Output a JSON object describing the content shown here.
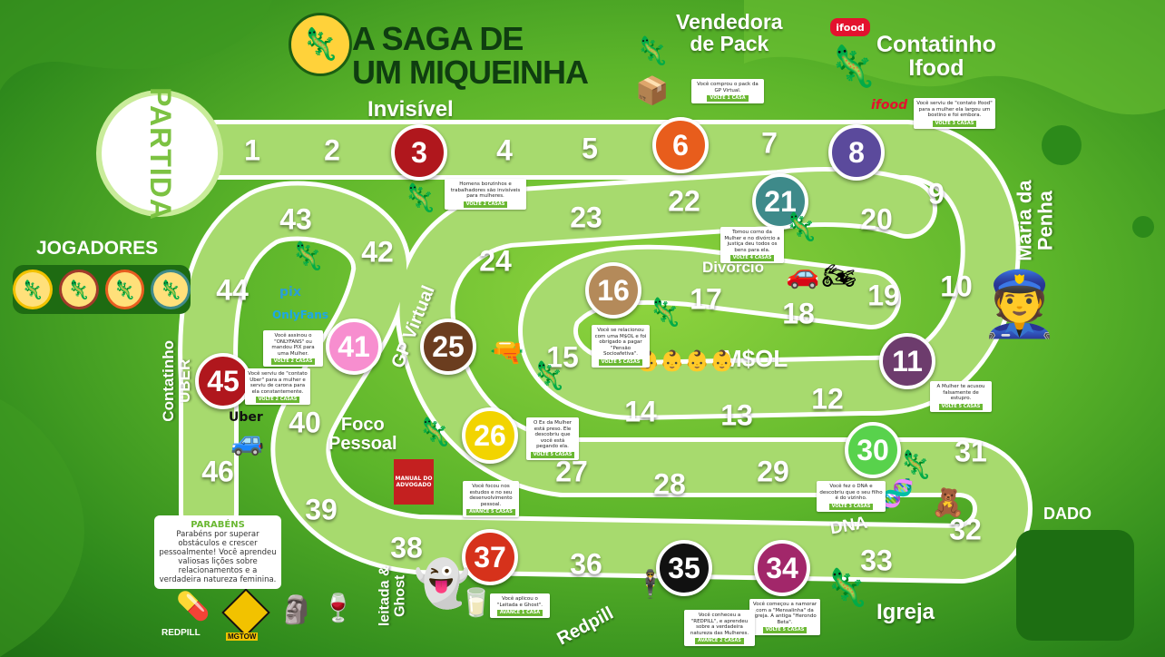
{
  "game": {
    "title_line1": "A SAGA DE",
    "title_line2": "UM MIQUEINHA",
    "start": "PARTIDA",
    "players_title": "JOGADORES",
    "dice_label": "DADO"
  },
  "players": [
    {
      "color": "#f2c200",
      "icon": "shrek-icon"
    },
    {
      "color": "#a23a2a",
      "icon": "shrek-icon"
    },
    {
      "color": "#e85d20",
      "icon": "shrek-icon"
    },
    {
      "color": "#3f8a8a",
      "icon": "shrek-icon"
    }
  ],
  "circles": [
    {
      "n": "3",
      "color": "#b0171d"
    },
    {
      "n": "6",
      "color": "#e85d1c"
    },
    {
      "n": "8",
      "color": "#5b4a9c"
    },
    {
      "n": "11",
      "color": "#6d3c6d"
    },
    {
      "n": "16",
      "color": "#b48a5a"
    },
    {
      "n": "21",
      "color": "#3e8a8a"
    },
    {
      "n": "25",
      "color": "#6b3d1f"
    },
    {
      "n": "26",
      "color": "#f2d400"
    },
    {
      "n": "30",
      "color": "#58d24c"
    },
    {
      "n": "34",
      "color": "#a2276a"
    },
    {
      "n": "35",
      "color": "#111111"
    },
    {
      "n": "37",
      "color": "#d6321b"
    },
    {
      "n": "41",
      "color": "#f78ecf"
    },
    {
      "n": "45",
      "color": "#b0171d"
    }
  ],
  "plain_numbers": [
    "1",
    "2",
    "4",
    "5",
    "7",
    "9",
    "10",
    "12",
    "13",
    "14",
    "15",
    "17",
    "18",
    "19",
    "20",
    "22",
    "23",
    "24",
    "27",
    "28",
    "29",
    "31",
    "32",
    "33",
    "36",
    "38",
    "39",
    "40",
    "42",
    "43",
    "44",
    "46"
  ],
  "labels": {
    "invisivel": "Invisível",
    "vendedora": "Vendedora\nde Pack",
    "ifood": "Contatinho\nIfood",
    "maria": "Maria da\nPenha",
    "divorcio": "Divórcio",
    "msol": "M$OL",
    "gp": "GP Virtual",
    "foco": "Foco\nPessoal",
    "uber": "Contatinho\nUBER",
    "dna": "DNA",
    "igreja": "Igreja",
    "redpill": "Redpill",
    "leitada": "leitada &\nGhost"
  },
  "logos": {
    "ifood": "ifood",
    "pix": "pix",
    "onlyfans": "OnlyFans",
    "uber": "Uber",
    "manual": "MANUAL DO ADVOGADO",
    "redpill_icon": "REDPILL",
    "mgtow_icon": "MGTOW"
  },
  "cards": {
    "c3": {
      "text": "Homens bonzinhos e trabalhadores são invisíveis para mulheres.",
      "action": "VOLTE 2 CASAS"
    },
    "c6": {
      "text": "Você comprou o pack da GP Virtual.",
      "action": "VOLTE 1 CASA"
    },
    "c8": {
      "text": "Você serviu de \"contato Ifood\" para a mulher ela largou um bostino e foi embora.",
      "action": "VOLTE 3 CASAS"
    },
    "c11": {
      "text": "A Mulher te acusou falsamente de estupro.",
      "action": "VOLTE 5 CASAS"
    },
    "c16": {
      "text": "Você se relacionou com uma M$OL e foi obrigado a pagar \"Pensão Socioafetiva\".",
      "action": "VOLTE 5 CASAS"
    },
    "c21": {
      "text": "Tomou corno da Mulher e no divórcio a justiça deu todos os bens para ela.",
      "action": "VOLTE 4 CASAS"
    },
    "c25": {
      "text": "O Ex da Mulher está preso. Ele descobriu que você está pegando ela.",
      "action": "VOLTE 5 CASAS"
    },
    "c26": {
      "text": "Você focou nos estudos e no seu desenvolvimento pessoal.",
      "action": "AVANCE 5 CASAS"
    },
    "c30": {
      "text": "Você fez o DNA e descobriu que o seu filho é do vizinho.",
      "action": "VOLTE 3 CASAS"
    },
    "c34": {
      "text": "Você começou a namorar com a \"Mensalinha\" da igreja. A antiga \"Herondo Beta\".",
      "action": "VOLTE 5 CASAS"
    },
    "c35": {
      "text": "Você conheceu a \"REDPILL\", e aprendeu sobre a verdadeira natureza das Mulheres.",
      "action": "AVANCE 2 CASAS"
    },
    "c37": {
      "text": "Você aplicou o \"Leitada e Ghost\".",
      "action": "AVANCE 1 CASA"
    },
    "c41": {
      "text": "Você assinou o \"ONLYFANS\" ou mandou PIX para uma Mulher.",
      "action": "VOLTE 2 CASAS"
    },
    "c45": {
      "text": "Você serviu de \"contato Uber\" para a mulher e serviu de carona para ela constantemente.",
      "action": "VOLTE 2 CASAS"
    }
  },
  "congrats": {
    "title": "PARABÉNS",
    "text": "Parabéns por superar obstáculos e crescer pessoalmente! Você aprendeu valiosas lições sobre relacionamentos e a verdadeira natureza feminina."
  },
  "colors": {
    "track": "#a7da6e",
    "track_light": "#c9ec9a",
    "dark_green": "#1e6b12"
  }
}
